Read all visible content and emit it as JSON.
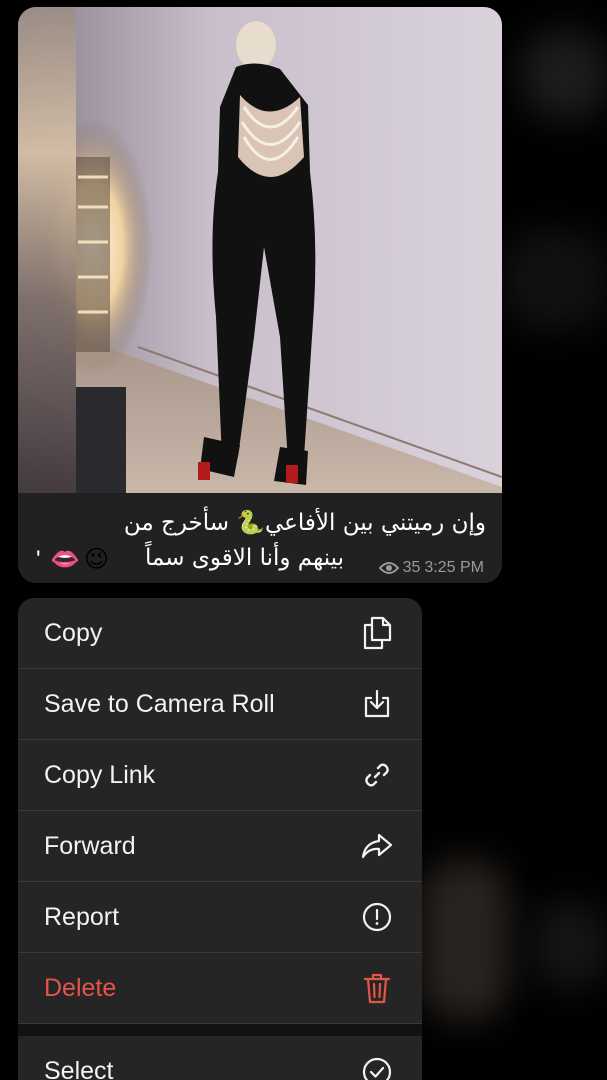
{
  "message": {
    "caption_line1": "وإن رميتني بين الأفاعي🐍 سأخرج من",
    "caption_line2": "بينهم وأنا الاقوى سماً",
    "caption_emojis": [
      "😉",
      "👄",
      "'"
    ],
    "views": "35",
    "time": "3:25 PM",
    "image_icon": "photo-of-woman-in-black-jumpsuit"
  },
  "menu": {
    "items": [
      {
        "label": "Copy",
        "icon": "copy-icon"
      },
      {
        "label": "Save to Camera Roll",
        "icon": "save-download-icon"
      },
      {
        "label": "Copy Link",
        "icon": "link-icon"
      },
      {
        "label": "Forward",
        "icon": "forward-arrow-icon"
      },
      {
        "label": "Report",
        "icon": "exclamation-circle-icon"
      },
      {
        "label": "Delete",
        "icon": "trash-icon",
        "color": "#e5544a"
      },
      {
        "label": "Select",
        "icon": "check-circle-icon"
      }
    ]
  }
}
